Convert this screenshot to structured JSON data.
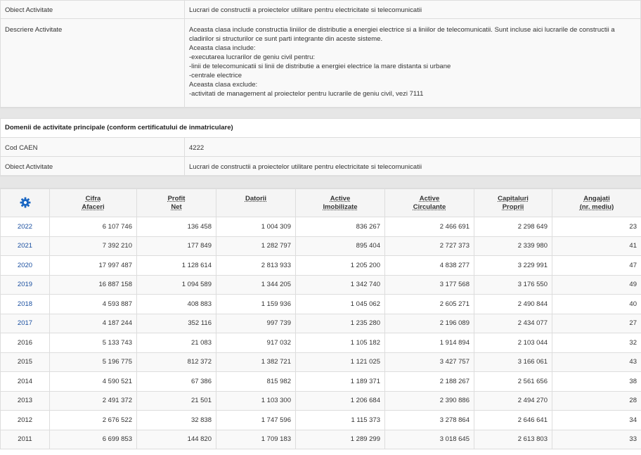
{
  "info": {
    "obiect_label": "Obiect Activitate",
    "obiect_value": "Lucrari de constructii a proiectelor utilitare pentru electricitate si telecomunicatii",
    "descriere_label": "Descriere Activitate",
    "descriere_lines": [
      "Aceasta clasa include constructia liniilor de distributie a energiei electrice si a liniilor de telecomunicatii. Sunt incluse aici lucrarile de constructii a",
      "cladirilor si structurilor ce sunt parti integrante din aceste sisteme.",
      "Aceasta clasa include:",
      "-executarea lucrarilor de geniu civil pentru:",
      "-linii de telecomunicatii si linii de distributie a energiei electrice la mare distanta si urbane",
      "-centrale electrice",
      "Aceasta clasa exclude:",
      "-activitati de management al proiectelor pentru lucrarile de geniu civil, vezi 7111"
    ]
  },
  "domenii": {
    "title": "Domenii de activitate principale (conform certificatului de inmatriculare)",
    "cod_label": "Cod CAEN",
    "cod_value": "4222",
    "obiect_label": "Obiect Activitate",
    "obiect_value": "Lucrari de constructii a proiectelor utilitare pentru electricitate si telecomunicatii"
  },
  "table": {
    "settings_icon": "gear-icon",
    "accent": "#1a4fa0",
    "headers": [
      {
        "l1": "Cifra",
        "l2": "Afaceri"
      },
      {
        "l1": "Profit",
        "l2": "Net"
      },
      {
        "l1": "Datorii",
        "l2": ""
      },
      {
        "l1": "Active",
        "l2": "Imobilizate"
      },
      {
        "l1": "Active",
        "l2": "Circulante"
      },
      {
        "l1": "Capitaluri",
        "l2": "Proprii"
      },
      {
        "l1": "Angajati",
        "l2": "(nr. mediu)"
      }
    ],
    "rows": [
      {
        "year": "2022",
        "link": true,
        "cells": [
          "6 107 746",
          "136 458",
          "1 004 309",
          "836 267",
          "2 466 691",
          "2 298 649",
          "23"
        ]
      },
      {
        "year": "2021",
        "link": true,
        "cells": [
          "7 392 210",
          "177 849",
          "1 282 797",
          "895 404",
          "2 727 373",
          "2 339 980",
          "41"
        ]
      },
      {
        "year": "2020",
        "link": true,
        "cells": [
          "17 997 487",
          "1 128 614",
          "2 813 933",
          "1 205 200",
          "4 838 277",
          "3 229 991",
          "47"
        ]
      },
      {
        "year": "2019",
        "link": true,
        "cells": [
          "16 887 158",
          "1 094 589",
          "1 344 205",
          "1 342 740",
          "3 177 568",
          "3 176 550",
          "49"
        ]
      },
      {
        "year": "2018",
        "link": true,
        "cells": [
          "4 593 887",
          "408 883",
          "1 159 936",
          "1 045 062",
          "2 605 271",
          "2 490 844",
          "40"
        ]
      },
      {
        "year": "2017",
        "link": true,
        "cells": [
          "4 187 244",
          "352 116",
          "997 739",
          "1 235 280",
          "2 196 089",
          "2 434 077",
          "27"
        ]
      },
      {
        "year": "2016",
        "link": false,
        "cells": [
          "5 133 743",
          "21 083",
          "917 032",
          "1 105 182",
          "1 914 894",
          "2 103 044",
          "32"
        ]
      },
      {
        "year": "2015",
        "link": false,
        "cells": [
          "5 196 775",
          "812 372",
          "1 382 721",
          "1 121 025",
          "3 427 757",
          "3 166 061",
          "43"
        ]
      },
      {
        "year": "2014",
        "link": false,
        "cells": [
          "4 590 521",
          "67 386",
          "815 982",
          "1 189 371",
          "2 188 267",
          "2 561 656",
          "38"
        ]
      },
      {
        "year": "2013",
        "link": false,
        "cells": [
          "2 491 372",
          "21 501",
          "1 103 300",
          "1 206 684",
          "2 390 886",
          "2 494 270",
          "28"
        ]
      },
      {
        "year": "2012",
        "link": false,
        "cells": [
          "2 676 522",
          "32 838",
          "1 747 596",
          "1 115 373",
          "3 278 864",
          "2 646 641",
          "34"
        ]
      },
      {
        "year": "2011",
        "link": false,
        "cells": [
          "6 699 853",
          "144 820",
          "1 709 183",
          "1 289 299",
          "3 018 645",
          "2 613 803",
          "33"
        ]
      }
    ]
  }
}
